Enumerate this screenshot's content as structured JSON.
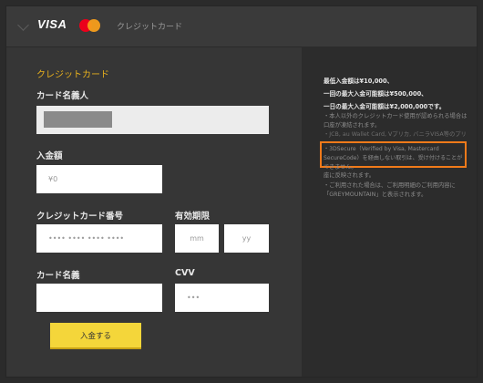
{
  "header": {
    "brand_visa": "VISA",
    "label": "クレジットカード"
  },
  "form": {
    "heading": "クレジットカード",
    "cardholder_label": "カード名義人",
    "amount_label": "入金額",
    "amount_placeholder": "¥0",
    "card_number_label": "クレジットカード番号",
    "card_number_placeholder": "•••• •••• •••• ••••",
    "expiry_label": "有効期限",
    "expiry_month_placeholder": "mm",
    "expiry_year_placeholder": "yy",
    "card_name_label": "カード名義",
    "cvv_label": "CVV",
    "cvv_placeholder": "•••",
    "submit_label": "入金する"
  },
  "info": {
    "min_deposit": "最低入金額は¥10,000、",
    "max_once": "一回の最大入金可能額は¥500,000、",
    "max_daily": "一日の最大入金可能額は¥2,000,000です。",
    "note1": "・本人以外のクレジットカード使用が認められる場合は口座が凍結されます。",
    "note2": "・JCB, au Wallet Card, Vプリカ, バニラVISA等のプリペイドカードはご利用いただけません。",
    "note3": "・3DSecure（Verified by Visa, Mastercard SecureCode）を経由しない取引は、受け付けることができません。",
    "note4": "座に反映されます。",
    "note5": "・ご利用された場合は、ご利用明細のご利用内容に「GREYMOUNTAIN」と表示されます。"
  },
  "colors": {
    "accent": "#e7b01d",
    "submit": "#f4d63a",
    "highlight": "#f07a1a"
  }
}
